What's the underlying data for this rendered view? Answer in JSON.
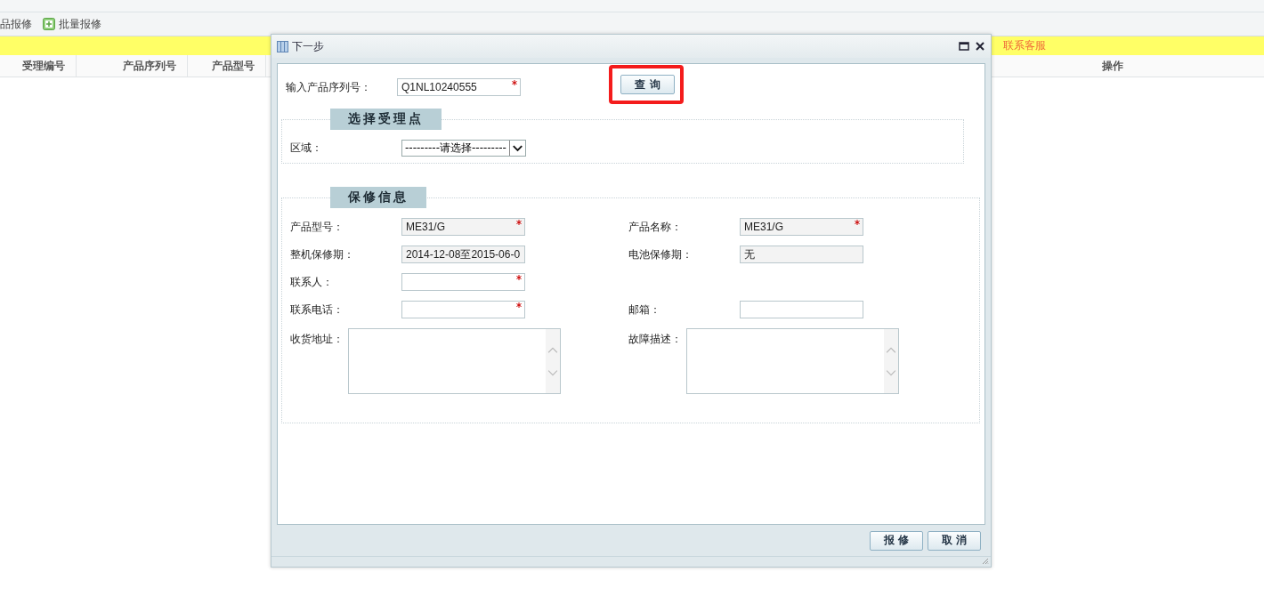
{
  "toolbar": {
    "items": [
      {
        "label": "品报修",
        "kind": "text"
      },
      {
        "label": "批量报修",
        "kind": "icon"
      }
    ]
  },
  "notice": {
    "link": "联系客服"
  },
  "table": {
    "columns": [
      {
        "label": "受理编号",
        "kind": "left"
      },
      {
        "label": "产品序列号",
        "kind": "left"
      },
      {
        "label": "产品型号",
        "kind": "left"
      },
      {
        "label": "操作",
        "kind": "right"
      }
    ]
  },
  "dialog": {
    "title": "下一步",
    "serial": {
      "label": "输入产品序列号：",
      "value": "Q1NL10240555",
      "required": true
    },
    "query_button": {
      "label": "查 询",
      "highlighted": true
    },
    "pickup_section": {
      "title": "选择受理点",
      "region_label": "区域：",
      "region_select": "---------请选择---------"
    },
    "warranty_section": {
      "title": "保修信息",
      "rows": [
        {
          "cells": [
            {
              "label": "产品型号：",
              "kind": "input",
              "value": "ME31/G",
              "required": true,
              "readonly": true
            },
            {
              "label": "产品名称：",
              "kind": "input",
              "value": "ME31/G",
              "required": true,
              "readonly": true
            }
          ]
        },
        {
          "cells": [
            {
              "label": "整机保修期：",
              "kind": "input",
              "value": "2014-12-08至2015-06-0",
              "required": false,
              "readonly": true
            },
            {
              "label": "电池保修期：",
              "kind": "input",
              "value": "无",
              "required": false,
              "readonly": true
            }
          ]
        },
        {
          "cells": [
            {
              "label": "联系人：",
              "kind": "input",
              "required": true,
              "readonly": false
            }
          ]
        },
        {
          "cells": [
            {
              "label": "联系电话：",
              "kind": "input",
              "required": true,
              "readonly": false
            },
            {
              "label": "邮箱：",
              "kind": "input",
              "required": false,
              "readonly": false
            }
          ]
        },
        {
          "cells": [
            {
              "label": "收货地址：",
              "kind": "textarea"
            },
            {
              "label": "故障描述：",
              "kind": "textarea"
            }
          ]
        }
      ]
    },
    "buttons": [
      "报 修",
      "取 消"
    ]
  }
}
